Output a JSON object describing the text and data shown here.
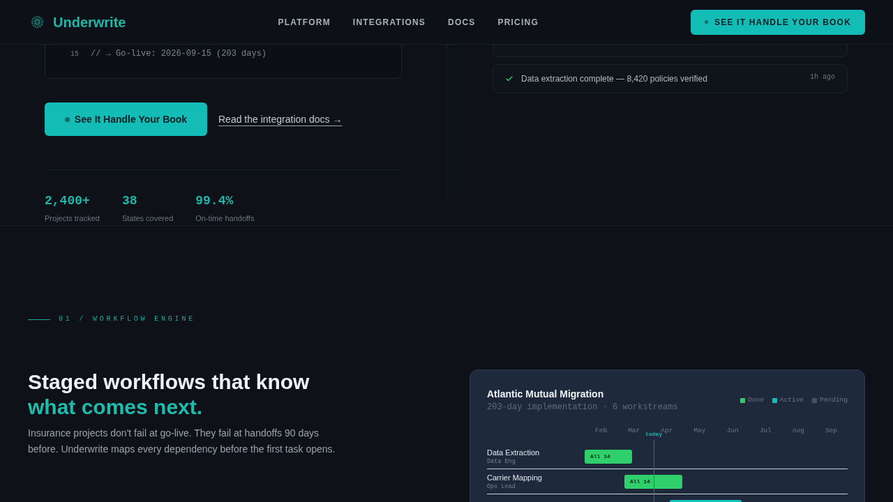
{
  "nav": {
    "brand": "Underwrite",
    "links": [
      "PLATFORM",
      "INTEGRATIONS",
      "DOCS",
      "PRICING"
    ],
    "cta": "SEE IT HANDLE YOUR BOOK"
  },
  "hero": {
    "code_lines": [
      {
        "number": "15",
        "text": "// → Go-live: 2026-09-15 (203 days)"
      }
    ],
    "primary_button": "See It Handle Your Book",
    "docs_link": "Read the integration docs →",
    "stats": [
      {
        "value": "2,400+",
        "label": "Projects tracked"
      },
      {
        "value": "38",
        "label": "States covered"
      },
      {
        "value": "99.4%",
        "label": "On-time handoffs"
      }
    ]
  },
  "activity": [
    {
      "kind": "success",
      "text": "Data extraction complete — 8,420 policies verified",
      "time": "1h ago"
    }
  ],
  "workflow_section": {
    "eyebrow": "01 / WORKFLOW ENGINE",
    "heading": [
      {
        "text": "Staged workflows that know",
        "accent": false
      },
      {
        "text": "what comes next.",
        "accent": true
      }
    ],
    "body": "Insurance projects don't fail at go-live. They fail at handoffs 90 days before. Underwrite maps every dependency before the first task opens.",
    "project_card": {
      "title": "Atlantic Mutual Migration",
      "subtitle": "203-day implementation · 6 workstreams",
      "legend": [
        {
          "kind": "done",
          "label": "Done",
          "color": "#2fcf6b"
        },
        {
          "kind": "active",
          "label": "Active",
          "color": "#14c2bc"
        },
        {
          "kind": "pending",
          "label": "Pending",
          "color": "#475262"
        }
      ],
      "timeline": {
        "months": [
          "Feb",
          "Mar",
          "Apr",
          "May",
          "Jun",
          "Jul",
          "Aug",
          "Sep"
        ],
        "today_label": "today"
      },
      "workstreams": [
        {
          "name": "Data Extraction",
          "owner": "Data Eng",
          "bar_label": "All 14",
          "kind": "done"
        },
        {
          "name": "Carrier Mapping",
          "owner": "Ops Lead",
          "bar_label": "All 14",
          "kind": "done"
        },
        {
          "kind": "active"
        }
      ]
    }
  }
}
